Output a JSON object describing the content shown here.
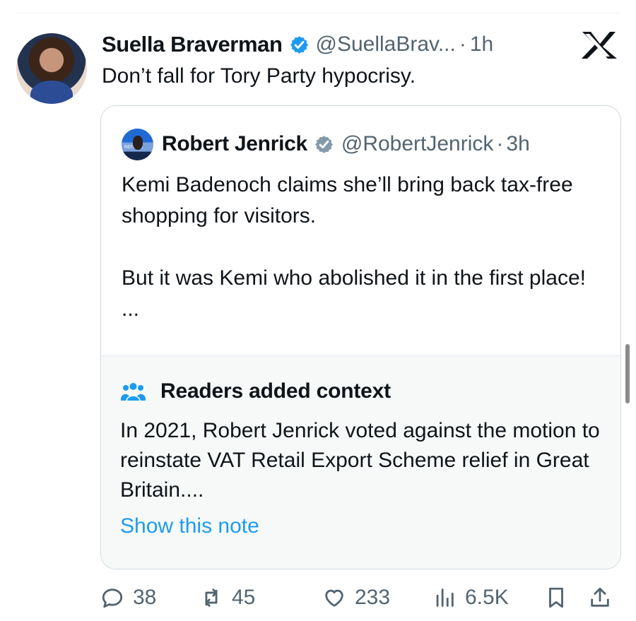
{
  "post": {
    "author_name": "Suella Braverman",
    "handle": "@SuellaBrav...",
    "separator": "·",
    "time": "1h",
    "text": "Don’t fall for Tory Party hypocrisy."
  },
  "quoted_post": {
    "author_name": "Robert Jenrick",
    "handle": "@RobertJenrick",
    "separator": "·",
    "time": "3h",
    "paragraph_1": "Kemi Badenoch claims she’ll bring back tax-free shopping for visitors.",
    "paragraph_2": "But it was Kemi who abolished it in the first place! ..."
  },
  "community_note": {
    "title": "Readers added context",
    "text": "In 2021, Robert Jenrick voted against the motion to reinstate VAT Retail Export Scheme relief in Great Britain....",
    "link_label": "Show this note"
  },
  "actions": {
    "replies": "38",
    "reposts": "45",
    "likes": "233",
    "views": "6.5K"
  },
  "colors": {
    "text": "#0f1419",
    "secondary": "#536471",
    "accent": "#1d9bf0",
    "context_background": "#f7f9f9"
  }
}
